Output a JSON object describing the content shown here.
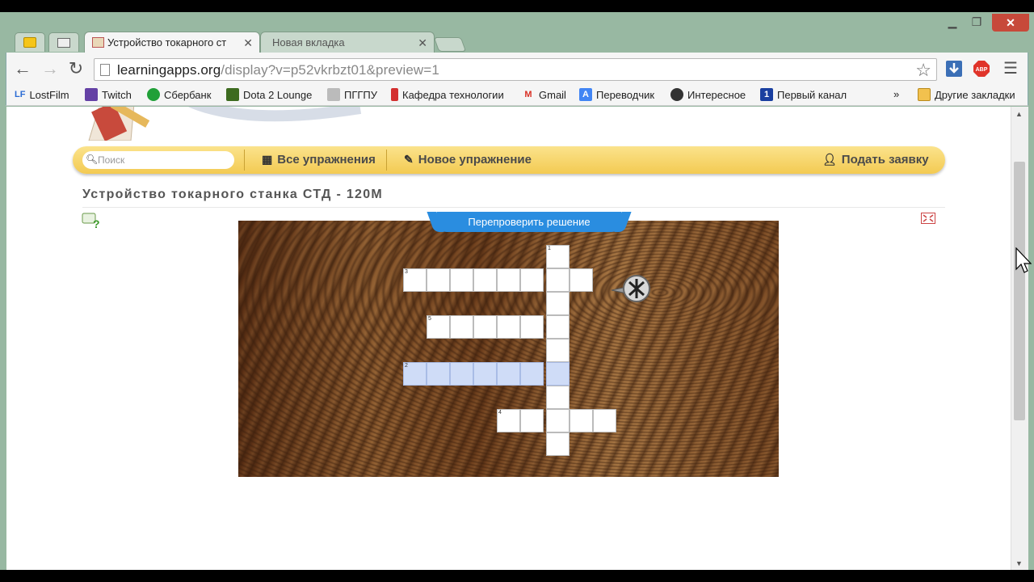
{
  "browser": {
    "tabs": [
      {
        "label": "Устройство токарного ст",
        "active": true
      },
      {
        "label": "Новая вкладка",
        "active": false
      }
    ],
    "url_host": "learningapps.org",
    "url_path": "/display?v=p52vkrbzt01&preview=1",
    "bookmarks": [
      {
        "label": "LostFilm",
        "icon": "lostfilm-icon",
        "color": "#2b6cd4"
      },
      {
        "label": "Twitch",
        "icon": "twitch-icon",
        "color": "#6441a5"
      },
      {
        "label": "Сбербанк",
        "icon": "sberbank-icon",
        "color": "#21a038"
      },
      {
        "label": "Dota 2 Lounge",
        "icon": "dota2-icon",
        "color": "#3d6b1f"
      },
      {
        "label": "ПГГПУ",
        "icon": "pggpu-icon",
        "color": "#999999"
      },
      {
        "label": "Кафедра технологии",
        "icon": "bookmark-ribbon-icon",
        "color": "#d32f2f"
      },
      {
        "label": "Gmail",
        "icon": "gmail-icon",
        "color": "#d93025"
      },
      {
        "label": "Переводчик",
        "icon": "translate-icon",
        "color": "#4285f4"
      },
      {
        "label": "Интересное",
        "icon": "spy-icon",
        "color": "#333333"
      },
      {
        "label": "Первый канал",
        "icon": "channel-one-icon",
        "color": "#1a3fa0"
      }
    ],
    "overflow_label": "»",
    "other_bookmarks": "Другие закладки"
  },
  "site": {
    "search_placeholder": "Поиск",
    "nav": {
      "all_exercises": "Все упражнения",
      "new_exercise": "Новое упражнение",
      "apply": "Подать заявку"
    },
    "page_title": "Устройство токарного станка СТД - 120М",
    "recheck_button": "Перепроверить решение"
  },
  "crossword": {
    "numbers": {
      "n1": "1",
      "n2": "2",
      "n3": "3",
      "n4": "4",
      "n5": "5"
    }
  },
  "colors": {
    "accent_blue": "#2a8de0",
    "nav_yellow": "#f3ca52",
    "highlight_cell": "#cfdcf7"
  }
}
